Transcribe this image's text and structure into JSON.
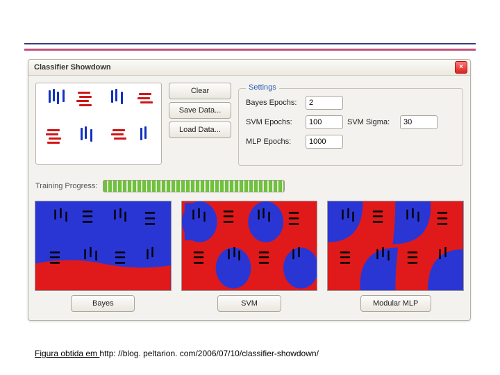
{
  "window": {
    "title": "Classifier Showdown",
    "buttons": {
      "clear": "Clear",
      "save": "Save Data...",
      "load": "Load Data..."
    }
  },
  "settings": {
    "legend": "Settings",
    "bayes_label": "Bayes Epochs:",
    "bayes_value": "2",
    "svm_epochs_label": "SVM Epochs:",
    "svm_epochs_value": "100",
    "svm_sigma_label": "SVM Sigma:",
    "svm_sigma_value": "30",
    "mlp_label": "MLP Epochs:",
    "mlp_value": "1000"
  },
  "progress": {
    "label": "Training Progress:"
  },
  "results": {
    "bayes": "Bayes",
    "svm": "SVM",
    "mlp": "Modular MLP"
  },
  "footnote": {
    "prefix": "Figura obtida em ",
    "url": "http: //blog. peltarion. com/2006/07/10/classifier-showdown/"
  },
  "colors": {
    "blue": "#2a36d4",
    "red": "#e01a1a"
  }
}
